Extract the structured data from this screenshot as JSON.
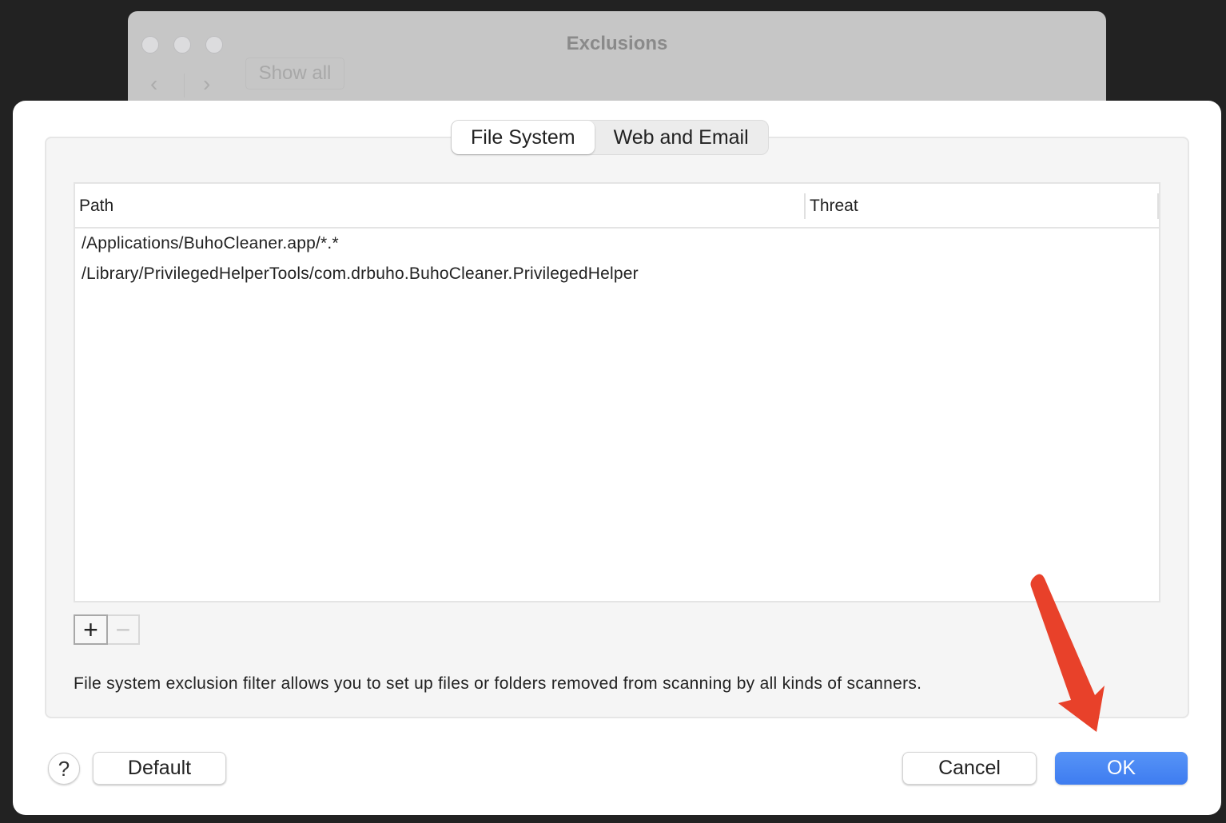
{
  "background_window": {
    "title": "Exclusions",
    "show_all_label": "Show all",
    "back_glyph": "‹",
    "forward_glyph": "›"
  },
  "sheet": {
    "tabs": [
      {
        "label": "File System",
        "active": true
      },
      {
        "label": "Web and Email",
        "active": false
      }
    ],
    "table": {
      "columns": [
        "Path",
        "Threat"
      ],
      "rows": [
        {
          "path": "/Applications/BuhoCleaner.app/*.*",
          "threat": ""
        },
        {
          "path": "/Library/PrivilegedHelperTools/com.drbuho.BuhoCleaner.PrivilegedHelper",
          "threat": ""
        }
      ]
    },
    "add_glyph": "+",
    "remove_glyph": "−",
    "description": "File system exclusion filter allows you to set up files or folders removed from scanning by all kinds of scanners.",
    "help_glyph": "?",
    "buttons": {
      "default": "Default",
      "cancel": "Cancel",
      "ok": "OK"
    }
  },
  "annotation": {
    "arrow_color": "#e8412a"
  },
  "colors": {
    "accent": "#3e7cf0"
  }
}
